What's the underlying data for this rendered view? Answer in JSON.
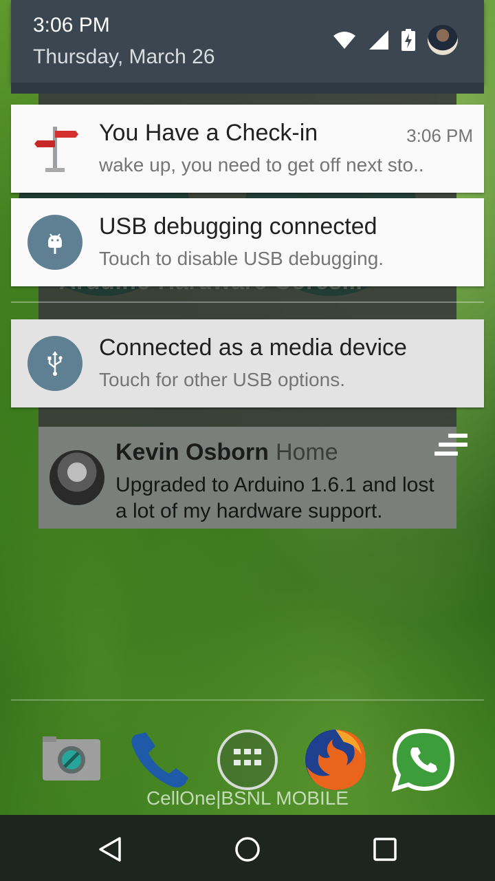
{
  "status": {
    "time": "3:06 PM",
    "date": "Thursday, March 26"
  },
  "notifications": [
    {
      "title": "You Have a Check-in",
      "subtitle": "wake up, you need to get off next sto..",
      "time": "3:06 PM",
      "icon": "signpost-icon"
    },
    {
      "title": "USB debugging connected",
      "subtitle": "Touch to disable USB debugging.",
      "icon": "android-debug-icon"
    },
    {
      "title": "Connected as a media device",
      "subtitle": "Touch for other USB options.",
      "icon": "usb-icon"
    }
  ],
  "background_app": {
    "header_text": "Arduino Hardware Cores...",
    "post": {
      "author": "Kevin Osborn",
      "location": "Home",
      "text": "Upgraded to Arduino 1.6.1 and lost a lot of my hardware support."
    }
  },
  "dock": {
    "apps": [
      "camera-icon",
      "phone-icon",
      "app-drawer-icon",
      "firefox-icon",
      "whatsapp-icon"
    ]
  },
  "carrier": "CellOne|BSNL MOBILE",
  "colors": {
    "shade_header": "#3b4650",
    "notification_bg": "#fafafa",
    "icon_circle": "#5f7f92"
  }
}
